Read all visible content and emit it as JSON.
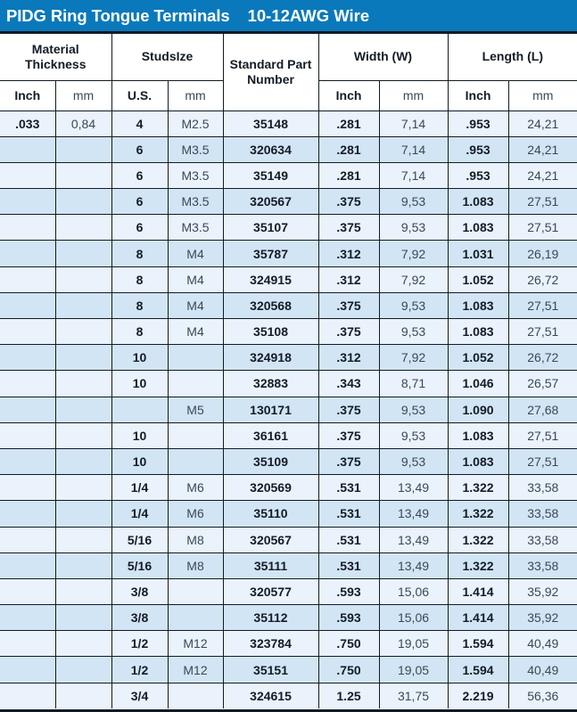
{
  "title": {
    "main": "PIDG Ring Tongue Terminals",
    "sub": "10-12AWG Wire",
    "banner_color": "#0a79bb",
    "banner_text_color": "#ffffff"
  },
  "colors": {
    "row_light": "#eaf2fb",
    "row_dark": "#d2e5f5",
    "border": "#111b23",
    "imperial_text": "#131c26",
    "metric_text": "#3a4856"
  },
  "table": {
    "group_headers": [
      {
        "label": "Material Thickness",
        "span": 2
      },
      {
        "label": "StudsIze",
        "span": 2
      },
      {
        "label": "Standard Part Number",
        "span": 1
      },
      {
        "label": "Width (W)",
        "span": 2
      },
      {
        "label": "Length (L)",
        "span": 2
      }
    ],
    "sub_headers": [
      "Inch",
      "mm",
      "U.S.",
      "mm",
      "Inch",
      "mm",
      "Inch",
      "mm"
    ],
    "columns": [
      "material_thickness_inch",
      "material_thickness_mm",
      "stud_size_us",
      "stud_size_mm",
      "standard_part_number",
      "width_inch",
      "width_mm",
      "length_inch",
      "length_mm"
    ],
    "rows": [
      {
        "material_thickness_inch": ".033",
        "material_thickness_mm": "0,84",
        "stud_size_us": "4",
        "stud_size_mm": "M2.5",
        "standard_part_number": "35148",
        "width_inch": ".281",
        "width_mm": "7,14",
        "length_inch": ".953",
        "length_mm": "24,21"
      },
      {
        "material_thickness_inch": "",
        "material_thickness_mm": "",
        "stud_size_us": "6",
        "stud_size_mm": "M3.5",
        "standard_part_number": "320634",
        "width_inch": ".281",
        "width_mm": "7,14",
        "length_inch": ".953",
        "length_mm": "24,21"
      },
      {
        "material_thickness_inch": "",
        "material_thickness_mm": "",
        "stud_size_us": "6",
        "stud_size_mm": "M3.5",
        "standard_part_number": "35149",
        "width_inch": ".281",
        "width_mm": "7,14",
        "length_inch": ".953",
        "length_mm": "24,21"
      },
      {
        "material_thickness_inch": "",
        "material_thickness_mm": "",
        "stud_size_us": "6",
        "stud_size_mm": "M3.5",
        "standard_part_number": "320567",
        "width_inch": ".375",
        "width_mm": "9,53",
        "length_inch": "1.083",
        "length_mm": "27,51"
      },
      {
        "material_thickness_inch": "",
        "material_thickness_mm": "",
        "stud_size_us": "6",
        "stud_size_mm": "M3.5",
        "standard_part_number": "35107",
        "width_inch": ".375",
        "width_mm": "9,53",
        "length_inch": "1.083",
        "length_mm": "27,51"
      },
      {
        "material_thickness_inch": "",
        "material_thickness_mm": "",
        "stud_size_us": "8",
        "stud_size_mm": "M4",
        "standard_part_number": "35787",
        "width_inch": ".312",
        "width_mm": "7,92",
        "length_inch": "1.031",
        "length_mm": "26,19"
      },
      {
        "material_thickness_inch": "",
        "material_thickness_mm": "",
        "stud_size_us": "8",
        "stud_size_mm": "M4",
        "standard_part_number": "324915",
        "width_inch": ".312",
        "width_mm": "7,92",
        "length_inch": "1.052",
        "length_mm": "26,72"
      },
      {
        "material_thickness_inch": "",
        "material_thickness_mm": "",
        "stud_size_us": "8",
        "stud_size_mm": "M4",
        "standard_part_number": "320568",
        "width_inch": ".375",
        "width_mm": "9,53",
        "length_inch": "1.083",
        "length_mm": "27,51"
      },
      {
        "material_thickness_inch": "",
        "material_thickness_mm": "",
        "stud_size_us": "8",
        "stud_size_mm": "M4",
        "standard_part_number": "35108",
        "width_inch": ".375",
        "width_mm": "9,53",
        "length_inch": "1.083",
        "length_mm": "27,51"
      },
      {
        "material_thickness_inch": "",
        "material_thickness_mm": "",
        "stud_size_us": "10",
        "stud_size_mm": "",
        "standard_part_number": "324918",
        "width_inch": ".312",
        "width_mm": "7,92",
        "length_inch": "1.052",
        "length_mm": "26,72"
      },
      {
        "material_thickness_inch": "",
        "material_thickness_mm": "",
        "stud_size_us": "10",
        "stud_size_mm": "",
        "standard_part_number": "32883",
        "width_inch": ".343",
        "width_mm": "8,71",
        "length_inch": "1.046",
        "length_mm": "26,57"
      },
      {
        "material_thickness_inch": "",
        "material_thickness_mm": "",
        "stud_size_us": "",
        "stud_size_mm": "M5",
        "standard_part_number": "130171",
        "width_inch": ".375",
        "width_mm": "9,53",
        "length_inch": "1.090",
        "length_mm": "27,68"
      },
      {
        "material_thickness_inch": "",
        "material_thickness_mm": "",
        "stud_size_us": "10",
        "stud_size_mm": "",
        "standard_part_number": "36161",
        "width_inch": ".375",
        "width_mm": "9,53",
        "length_inch": "1.083",
        "length_mm": "27,51"
      },
      {
        "material_thickness_inch": "",
        "material_thickness_mm": "",
        "stud_size_us": "10",
        "stud_size_mm": "",
        "standard_part_number": "35109",
        "width_inch": ".375",
        "width_mm": "9,53",
        "length_inch": "1.083",
        "length_mm": "27,51"
      },
      {
        "material_thickness_inch": "",
        "material_thickness_mm": "",
        "stud_size_us": "1/4",
        "stud_size_mm": "M6",
        "standard_part_number": "320569",
        "width_inch": ".531",
        "width_mm": "13,49",
        "length_inch": "1.322",
        "length_mm": "33,58"
      },
      {
        "material_thickness_inch": "",
        "material_thickness_mm": "",
        "stud_size_us": "1/4",
        "stud_size_mm": "M6",
        "standard_part_number": "35110",
        "width_inch": ".531",
        "width_mm": "13,49",
        "length_inch": "1.322",
        "length_mm": "33,58"
      },
      {
        "material_thickness_inch": "",
        "material_thickness_mm": "",
        "stud_size_us": "5/16",
        "stud_size_mm": "M8",
        "standard_part_number": "320567",
        "width_inch": ".531",
        "width_mm": "13,49",
        "length_inch": "1.322",
        "length_mm": "33,58"
      },
      {
        "material_thickness_inch": "",
        "material_thickness_mm": "",
        "stud_size_us": "5/16",
        "stud_size_mm": "M8",
        "standard_part_number": "35111",
        "width_inch": ".531",
        "width_mm": "13,49",
        "length_inch": "1.322",
        "length_mm": "33,58"
      },
      {
        "material_thickness_inch": "",
        "material_thickness_mm": "",
        "stud_size_us": "3/8",
        "stud_size_mm": "",
        "standard_part_number": "320577",
        "width_inch": ".593",
        "width_mm": "15,06",
        "length_inch": "1.414",
        "length_mm": "35,92"
      },
      {
        "material_thickness_inch": "",
        "material_thickness_mm": "",
        "stud_size_us": "3/8",
        "stud_size_mm": "",
        "standard_part_number": "35112",
        "width_inch": ".593",
        "width_mm": "15,06",
        "length_inch": "1.414",
        "length_mm": "35,92"
      },
      {
        "material_thickness_inch": "",
        "material_thickness_mm": "",
        "stud_size_us": "1/2",
        "stud_size_mm": "M12",
        "standard_part_number": "323784",
        "width_inch": ".750",
        "width_mm": "19,05",
        "length_inch": "1.594",
        "length_mm": "40,49"
      },
      {
        "material_thickness_inch": "",
        "material_thickness_mm": "",
        "stud_size_us": "1/2",
        "stud_size_mm": "M12",
        "standard_part_number": "35151",
        "width_inch": ".750",
        "width_mm": "19,05",
        "length_inch": "1.594",
        "length_mm": "40,49"
      },
      {
        "material_thickness_inch": "",
        "material_thickness_mm": "",
        "stud_size_us": "3/4",
        "stud_size_mm": "",
        "standard_part_number": "324615",
        "width_inch": "1.25",
        "width_mm": "31,75",
        "length_inch": "2.219",
        "length_mm": "56,36"
      }
    ]
  }
}
